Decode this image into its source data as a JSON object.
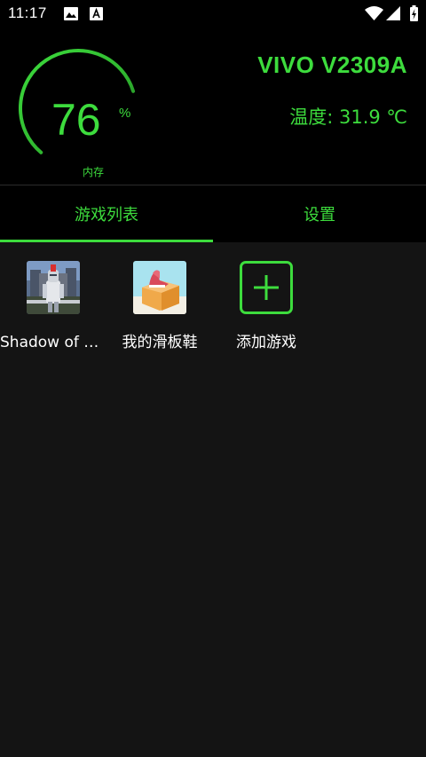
{
  "status_bar": {
    "time": "11:17"
  },
  "header": {
    "memory_value": "76",
    "memory_unit": "%",
    "memory_label": "内存",
    "memory_percent": 76,
    "device_name": "VIVO V2309A",
    "temperature": "温度: 31.9 ℃"
  },
  "tabs": [
    {
      "label": "游戏列表",
      "selected": true
    },
    {
      "label": "设置",
      "selected": false
    }
  ],
  "games": [
    {
      "label": "Shadow of R...",
      "icon": "knight-game-icon"
    },
    {
      "label": "我的滑板鞋",
      "icon": "sneaker-game-icon"
    },
    {
      "label": "添加游戏",
      "icon": "add-icon"
    }
  ],
  "colors": {
    "accent": "#3ddc3d",
    "background": "#141414",
    "header_background": "#000000",
    "text": "#ffffff"
  }
}
